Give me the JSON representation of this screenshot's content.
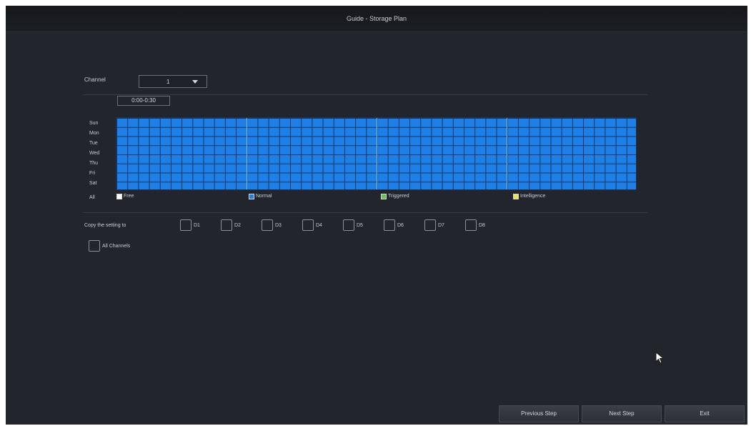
{
  "window": {
    "title": "Guide - Storage Plan"
  },
  "channel": {
    "label": "Channel",
    "value": "1"
  },
  "schedule": {
    "time_range": "0:00-0:30",
    "days": [
      "Sun",
      "Mon",
      "Tue",
      "Wed",
      "Thu",
      "Fri",
      "Sat"
    ],
    "all_label": "All",
    "legend": [
      {
        "label": "Free",
        "color": "#ffffff"
      },
      {
        "label": "Normal",
        "color": "#1e7fe6"
      },
      {
        "label": "Triggered",
        "color": "#6cc04a"
      },
      {
        "label": "Intelligence",
        "color": "#f2e24a"
      }
    ]
  },
  "copy": {
    "label": "Copy the setting to",
    "channels": [
      "D1",
      "D2",
      "D3",
      "D4",
      "D5",
      "D6",
      "D7",
      "D8"
    ],
    "all_channels_label": "All Channels"
  },
  "footer": {
    "previous_label": "Previous Step",
    "next_label": "Next Step",
    "exit_label": "Exit"
  },
  "icons": {
    "cursor": "mouse-pointer-icon",
    "dropdown": "triangle-down-icon"
  }
}
